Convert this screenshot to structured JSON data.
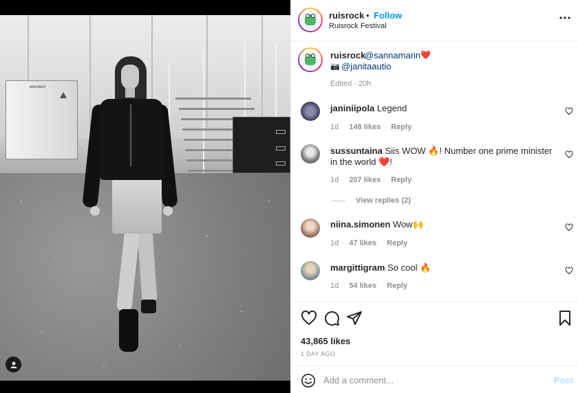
{
  "post": {
    "author": "ruisrock",
    "dot": "•",
    "follow_label": "Follow",
    "location": "Ruisrock Festival"
  },
  "caption": {
    "user": "ruisrock",
    "mention": "@sannamarin",
    "heart": "❤️",
    "camera": "📷",
    "credit": "@janitaautio",
    "meta": "Edited · 20h"
  },
  "comments": [
    {
      "user": "janiniipola",
      "text": "Legend",
      "time": "1d",
      "likes": "148 likes",
      "reply": "Reply"
    },
    {
      "user": "sussuntaina",
      "text": "Siis WOW 🔥! Number one prime minister in the world ❤️!",
      "time": "1d",
      "likes": "207 likes",
      "reply": "Reply"
    },
    {
      "user": "niina.simonen",
      "text": "Wow🙌",
      "time": "1d",
      "likes": "47 likes",
      "reply": "Reply"
    },
    {
      "user": "margittigram",
      "text": "So cool 🔥",
      "time": "1d",
      "likes": "54 likes",
      "reply": "Reply"
    }
  ],
  "view_replies": "View replies (2)",
  "photo": {
    "cabinet_label": "RAMIRENT"
  },
  "stats": {
    "likes": "43,865 likes",
    "posted": "1 DAY AGO"
  },
  "composer": {
    "placeholder": "Add a comment...",
    "post_label": "Post"
  },
  "icons": {
    "more": "more-options-icon",
    "like": "heart-icon",
    "comment": "comment-icon",
    "share": "share-icon",
    "save": "bookmark-icon",
    "emoji": "emoji-icon",
    "tag": "user-tag-icon"
  },
  "colors": {
    "accent": "#0095f6",
    "link": "#00376b",
    "muted": "#8e8e8e",
    "post_disabled": "#b2dffc"
  }
}
